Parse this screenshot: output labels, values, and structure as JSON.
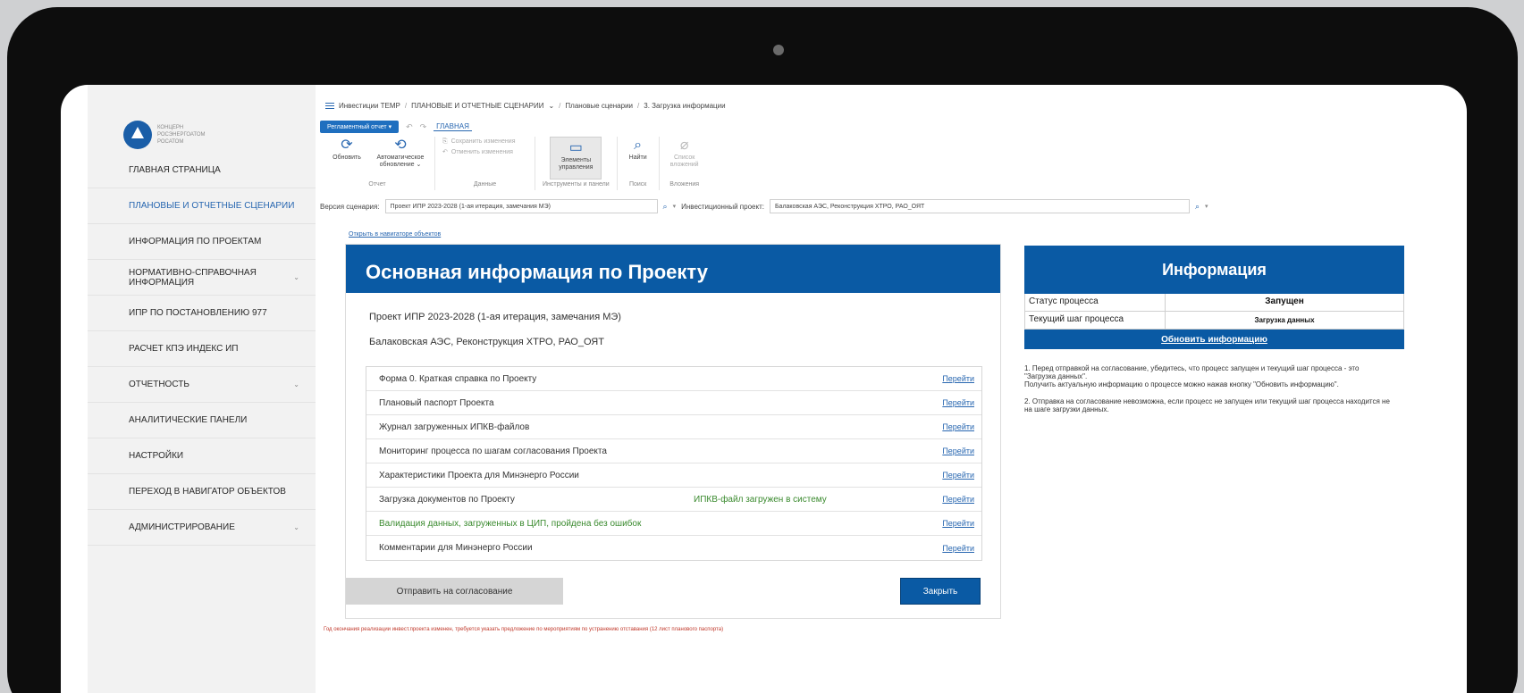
{
  "sidebar": {
    "logo_lines": [
      "КОНЦЕРН",
      "РОСЭНЕРГОАТОМ",
      "РОСАТОМ"
    ],
    "items": [
      {
        "label": "ГЛАВНАЯ СТРАНИЦА",
        "chevron": ""
      },
      {
        "label": "ПЛАНОВЫЕ И ОТЧЕТНЫЕ СЦЕНАРИИ",
        "chevron": ""
      },
      {
        "label": "ИНФОРМАЦИЯ ПО ПРОЕКТАМ",
        "chevron": ""
      },
      {
        "label": "НОРМАТИВНО-СПРАВОЧНАЯ ИНФОРМАЦИЯ",
        "chevron": "⌄"
      },
      {
        "label": "ИПР ПО ПОСТАНОВЛЕНИЮ 977",
        "chevron": ""
      },
      {
        "label": "РАСЧЕТ КПЭ ИНДЕКС ИП",
        "chevron": ""
      },
      {
        "label": "ОТЧЕТНОСТЬ",
        "chevron": "⌄"
      },
      {
        "label": "АНАЛИТИЧЕСКИЕ ПАНЕЛИ",
        "chevron": ""
      },
      {
        "label": "НАСТРОЙКИ",
        "chevron": ""
      },
      {
        "label": "ПЕРЕХОД В НАВИГАТОР ОБЪЕКТОВ",
        "chevron": ""
      },
      {
        "label": "АДМИНИСТРИРОВАНИЕ",
        "chevron": "⌄"
      }
    ]
  },
  "breadcrumb": {
    "items": [
      "Инвестиции TEMP",
      "ПЛАНОВЫЕ И ОТЧЕТНЫЕ СЦЕНАРИИ",
      "Плановые сценарии",
      "3. Загрузка информации"
    ],
    "dropdown_mark": "⌄"
  },
  "toolbar": {
    "mode_button": "Регламентный отчет ▾",
    "undo": "↶",
    "redo": "↷",
    "main_tab": "ГЛАВНАЯ",
    "refresh": "Обновить",
    "auto_refresh": "Автоматическое обновление ⌄",
    "save_changes": "Сохранить изменения",
    "cancel_changes": "Отменить изменения",
    "controls": "Элементы управления",
    "find": "Найти",
    "attachments": "Список вложений",
    "group_report": "Отчет",
    "group_data": "Данные",
    "group_tools": "Инструменты и панели",
    "group_search": "Поиск",
    "group_attachments": "Вложения"
  },
  "filters": {
    "version_label": "Версия сценария:",
    "version_value": "Проект ИПР 2023-2028 (1-ая итерация, замечания МЭ)",
    "project_label": "Инвестиционный проект:",
    "project_value": "Балаковская АЭС, Реконструкция ХТРО, РАО_ОЯТ"
  },
  "nav_link": "Открыть в навигаторе объектов",
  "main": {
    "title": "Основная информация по Проекту",
    "project_version": "Проект ИПР 2023-2028 (1-ая итерация, замечания МЭ)",
    "project_name": "Балаковская АЭС, Реконструкция ХТРО, РАО_ОЯТ",
    "go_label": "Перейти",
    "rows": [
      {
        "label": "Форма 0. Краткая справка по Проекту",
        "status": "",
        "green": false
      },
      {
        "label": "Плановый паспорт Проекта",
        "status": "",
        "green": false
      },
      {
        "label": "Журнал загруженных ИПКВ-файлов",
        "status": "",
        "green": false
      },
      {
        "label": "Мониторинг процесса по шагам согласования Проекта",
        "status": "",
        "green": false
      },
      {
        "label": "Характеристики Проекта для Минэнерго России",
        "status": "",
        "green": false
      },
      {
        "label": "Загрузка документов по Проекту",
        "status": "ИПКВ-файл загружен в систему",
        "green": false
      },
      {
        "label": "Валидация данных, загруженных в ЦИП, пройдена без ошибок",
        "status": "",
        "green": true
      },
      {
        "label": "Комментарии для Минэнерго России",
        "status": "",
        "green": false
      }
    ],
    "send_button": "Отправить на согласование",
    "close_button": "Закрыть"
  },
  "info": {
    "title": "Информация",
    "status_label": "Статус процесса",
    "status_value": "Запущен",
    "step_label": "Текущий шаг процесса",
    "step_value": "Загрузка данных",
    "refresh_link": "Обновить информацию",
    "note1": "1. Перед отправкой на согласование, убедитесь, что процесс запущен и текущий шаг процесса - это \"Загрузка данных\".",
    "note1b": "Получить актуальную информацию о процессе можно нажав кнопку \"Обновить информацию\".",
    "note2": "2. Отправка на согласование невозможна, если процесс не запущен или текущий шаг процесса находится не на шаге загрузки данных."
  },
  "warning": "Год окончания реализации инвест.проекта изменен, требуется указать предложение по мероприятиям по устранению отставания (12 лист планового паспорта)",
  "colors": {
    "accent": "#0a5aa4",
    "green": "#3a8a2e",
    "warning": "#c0392b"
  }
}
